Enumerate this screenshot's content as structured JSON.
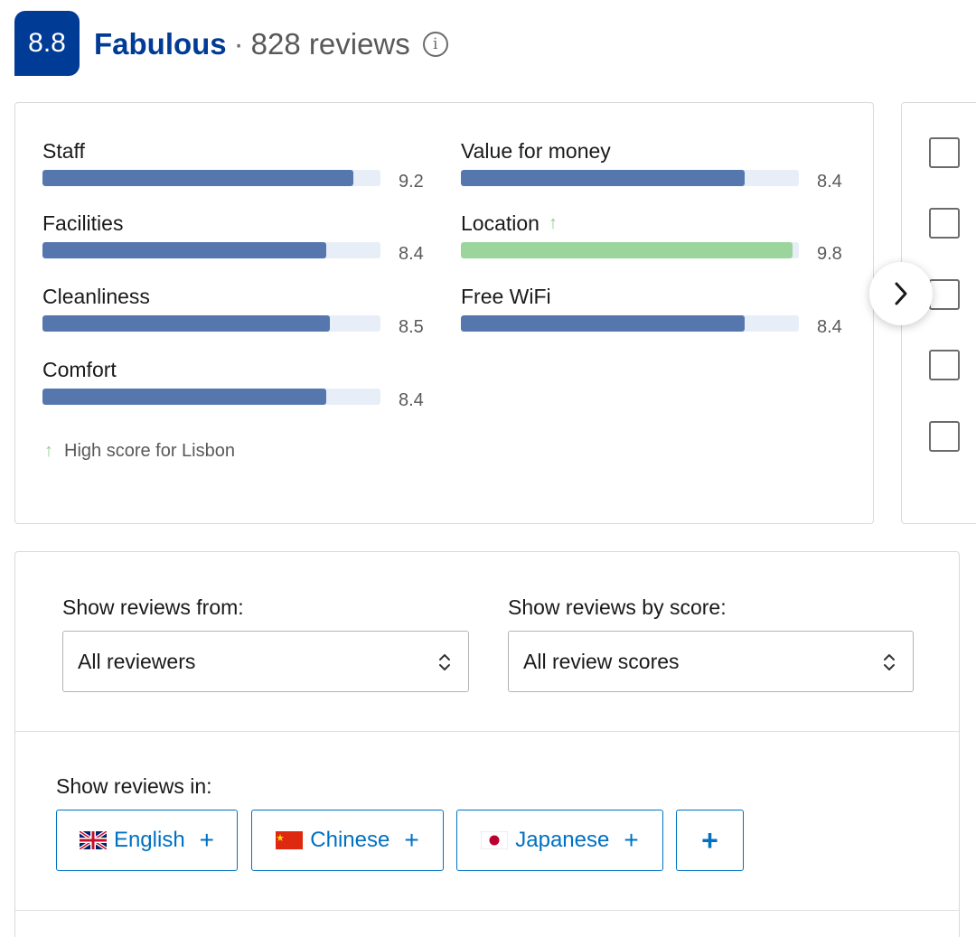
{
  "header": {
    "score": "8.8",
    "rating_word": "Fabulous",
    "separator": "·",
    "review_count": "828 reviews",
    "info_icon": "info-icon"
  },
  "categories": [
    {
      "label": "Staff",
      "value": "9.2",
      "fraction": 0.92,
      "high": false
    },
    {
      "label": "Facilities",
      "value": "8.4",
      "fraction": 0.84,
      "high": false
    },
    {
      "label": "Cleanliness",
      "value": "8.5",
      "fraction": 0.85,
      "high": false
    },
    {
      "label": "Comfort",
      "value": "8.4",
      "fraction": 0.84,
      "high": false
    },
    {
      "label": "Value for money",
      "value": "8.4",
      "fraction": 0.84,
      "high": false
    },
    {
      "label": "Location",
      "value": "9.8",
      "fraction": 0.98,
      "high": true
    },
    {
      "label": "Free WiFi",
      "value": "8.4",
      "fraction": 0.84,
      "high": false
    }
  ],
  "high_score_note": "High score for Lisbon",
  "colors": {
    "brand": "#003b95",
    "bar": "#5577ae",
    "bar_high": "#9bd59d",
    "link": "#0071c2"
  },
  "filters": {
    "from_label": "Show reviews from:",
    "from_value": "All reviewers",
    "score_label": "Show reviews by score:",
    "score_value": "All review scores",
    "lang_label": "Show reviews in:",
    "languages": [
      {
        "label": "English",
        "flag": "uk-flag-icon"
      },
      {
        "label": "Chinese",
        "flag": "china-flag-icon"
      },
      {
        "label": "Japanese",
        "flag": "japan-flag-icon"
      }
    ],
    "more_languages": "+"
  }
}
